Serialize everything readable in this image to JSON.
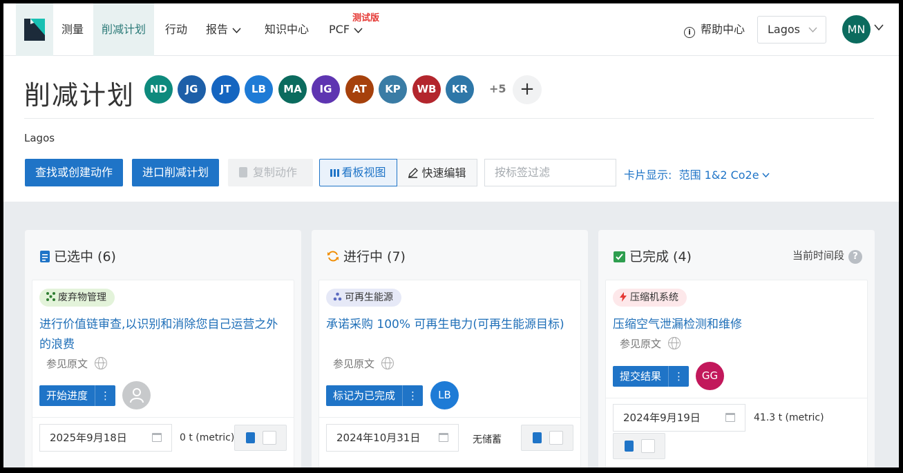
{
  "nav": {
    "items": [
      {
        "label": "测量"
      },
      {
        "label": "削减计划"
      },
      {
        "label": "行动"
      },
      {
        "label": "报告"
      },
      {
        "label": "知识中心"
      },
      {
        "label": "PCF"
      }
    ],
    "beta_badge": "测试版",
    "help_label": "帮助中心",
    "location": "Lagos",
    "user_initials": "MN"
  },
  "page": {
    "title": "削减计划",
    "subtitle": "Lagos",
    "members": [
      {
        "initials": "ND",
        "color": "#0e8a7d"
      },
      {
        "initials": "JG",
        "color": "#1d5fa8"
      },
      {
        "initials": "JT",
        "color": "#1565c0"
      },
      {
        "initials": "LB",
        "color": "#1e7bd6"
      },
      {
        "initials": "MA",
        "color": "#0b6b5e"
      },
      {
        "initials": "IG",
        "color": "#5e35b1"
      },
      {
        "initials": "AT",
        "color": "#a6410c"
      },
      {
        "initials": "KP",
        "color": "#3a7ca5"
      },
      {
        "initials": "WB",
        "color": "#b3262d"
      },
      {
        "initials": "KR",
        "color": "#2e77a8"
      }
    ],
    "more_members": "+5",
    "add_member_icon": "plus-icon"
  },
  "toolbar": {
    "find_create": "查找或创建动作",
    "import_plan": "进口削减计划",
    "copy_action": "复制动作",
    "kanban_view": "看板视图",
    "quick_edit": "快速编辑",
    "tag_filter_placeholder": "按标签过滤",
    "card_display_label": "卡片显示:",
    "card_display_value": "范围 1&2 Co2e"
  },
  "columns": [
    {
      "title": "已选中 (6)",
      "icon": "clipboard-icon",
      "card": {
        "tag": "废弃物管理",
        "tag_color": "#e3f3da",
        "title": "进行价值链审查,以识别和消除您自己运营之外的浪费",
        "source": "参见原文",
        "action": "开始进度",
        "assignee": "",
        "date": "2025年9月18日",
        "metric": "0 t (metric)"
      }
    },
    {
      "title": "进行中 (7)",
      "icon": "sync-icon",
      "card": {
        "tag": "可再生能源",
        "tag_color": "#e6e9f7",
        "title": "承诺采购 100% 可再生电力(可再生能源目标)",
        "source": "参见原文",
        "action": "标记为已完成",
        "assignee": "LB",
        "assignee_color": "#1e7bd6",
        "date": "2024年10月31日",
        "metric": "无储蓄"
      }
    },
    {
      "title": "已完成 (4)",
      "icon": "check-square-icon",
      "period": "当前时间段",
      "card": {
        "tag": "压缩机系统",
        "tag_color": "#fde8ea",
        "title": "压缩空气泄漏检测和维修",
        "source": "参见原文",
        "action": "提交结果",
        "assignee": "GG",
        "assignee_color": "#c2185b",
        "date": "2024年9月19日",
        "metric": "41.3 t (metric)"
      }
    }
  ]
}
